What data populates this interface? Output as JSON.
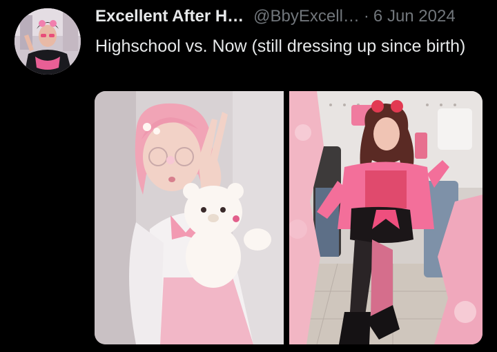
{
  "tweet": {
    "author_name": "Excellent After H…",
    "handle": "@BbyExcell…",
    "separator": "·",
    "date": "6 Jun 2024",
    "text": "Highschool vs. Now (still dressing up since birth)"
  },
  "media": {
    "images": [
      {
        "name": "highschool-photo"
      },
      {
        "name": "now-photo"
      }
    ]
  },
  "colors": {
    "background": "#000000",
    "primary_text": "#e7e9ea",
    "secondary_text": "#71767b",
    "accent_pink": "#f4a7bd"
  }
}
